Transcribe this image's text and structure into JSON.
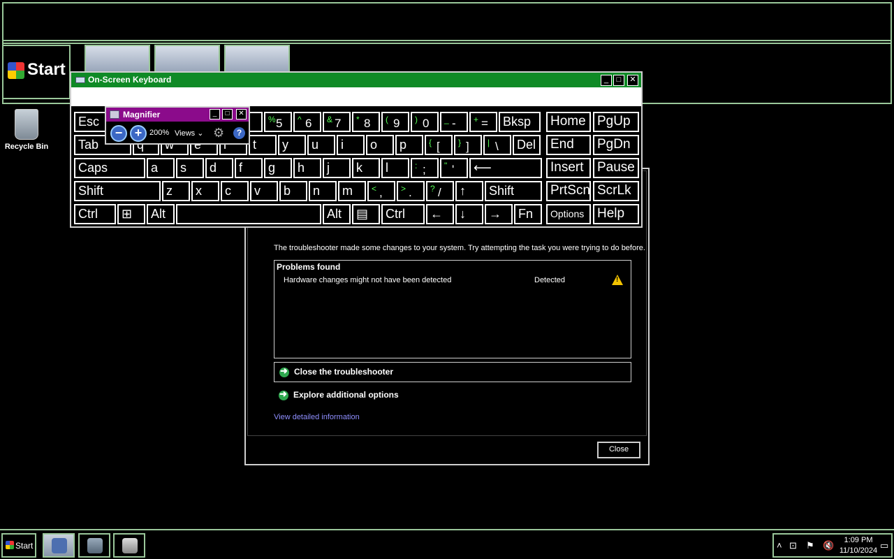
{
  "magnifier_view": {
    "start_label": "Start"
  },
  "desktop": {
    "recycle_bin": "Recycle Bin"
  },
  "troubleshooter": {
    "message": "The troubleshooter made some changes to your system. Try attempting the task you were trying to do before.",
    "problems_header": "Problems found",
    "problems": [
      {
        "name": "Hardware changes might not have been detected",
        "status": "Detected",
        "icon": "warning-icon"
      }
    ],
    "close_link": "Close the troubleshooter",
    "explore_link": "Explore additional options",
    "detail_link": "View detailed information",
    "close_button": "Close",
    "link_color": "#8f8fff"
  },
  "osk": {
    "title": "On-Screen Keyboard",
    "title_color": "#0f8a26",
    "shift_color": "#55ff55",
    "keys": {
      "esc": "Esc",
      "k4": "4",
      "k5_shift": "%",
      "k5": "5",
      "k6_shift": "^",
      "k6": "6",
      "k7_shift": "&",
      "k7": "7",
      "k8_shift": "*",
      "k8": "8",
      "k9_shift": "(",
      "k9": "9",
      "k0_shift": ")",
      "k0": "0",
      "minus_shift": "_",
      "minus": "-",
      "plus_shift": "+",
      "equals": "=",
      "bksp": "Bksp",
      "home": "Home",
      "pgup": "PgUp",
      "tab": "Tab",
      "q": "q",
      "w": "w",
      "e": "e",
      "r": "r",
      "t": "t",
      "y": "y",
      "u": "u",
      "i": "i",
      "o": "o",
      "p": "p",
      "lbracket_shift": "{",
      "lbracket": "[",
      "rbracket_shift": "}",
      "rbracket": "]",
      "backslash_shift": "|",
      "backslash": "\\",
      "del": "Del",
      "end": "End",
      "pgdn": "PgDn",
      "caps": "Caps",
      "a": "a",
      "s": "s",
      "d": "d",
      "f": "f",
      "g": "g",
      "h": "h",
      "j": "j",
      "k": "k",
      "l": "l",
      "semicolon_shift": ":",
      "semicolon": ";",
      "quote_shift": "\"",
      "quote": "'",
      "enter": "⟵",
      "insert": "Insert",
      "pause": "Pause",
      "shift_left": "Shift",
      "z": "z",
      "x": "x",
      "c": "c",
      "v": "v",
      "b": "b",
      "n": "n",
      "m": "m",
      "comma_shift": "<",
      "comma": ",",
      "period_shift": ">",
      "period": ".",
      "slash_shift": "?",
      "slash": "/",
      "up": "↑",
      "shift_right": "Shift",
      "prtscn": "PrtScn",
      "scrlk": "ScrLk",
      "ctrl_left": "Ctrl",
      "win": "⊞",
      "alt_left": "Alt",
      "alt_right": "Alt",
      "menu": "▤",
      "ctrl_right": "Ctrl",
      "left": "←",
      "down": "↓",
      "right": "→",
      "fn": "Fn",
      "options": "Options",
      "help": "Help"
    }
  },
  "magnifier": {
    "title": "Magnifier",
    "title_color": "#8b0b8b",
    "zoom": "200%",
    "views": "Views",
    "zoom_out": "−",
    "zoom_in": "+",
    "help": "?"
  },
  "taskbar": {
    "start_label": "Start",
    "time": "1:09 PM",
    "date": "11/10/2024"
  }
}
